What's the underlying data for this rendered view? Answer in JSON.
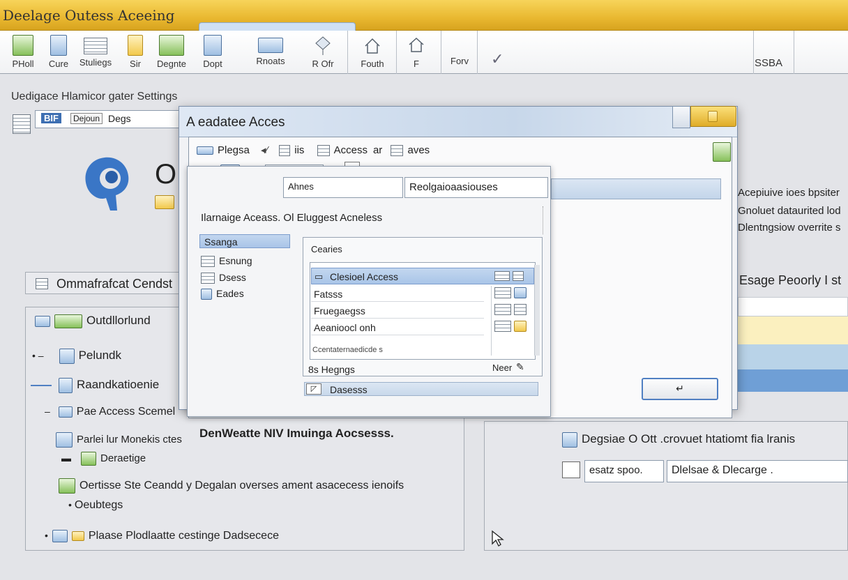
{
  "window": {
    "title": "Deelage Outess Aceeing"
  },
  "ribbon": {
    "buttons": [
      {
        "label": "PHoll"
      },
      {
        "label": "Cure"
      },
      {
        "label": "Stuliegs"
      },
      {
        "label": "Sir"
      },
      {
        "label": "Degnte"
      },
      {
        "label": "Dopt"
      },
      {
        "label": "Rnoats"
      },
      {
        "label": "R Ofr"
      },
      {
        "label": "Fouth"
      },
      {
        "label": "F"
      },
      {
        "label": "Forv"
      }
    ],
    "check_glyph": "✓",
    "right_label": "SSBA"
  },
  "background": {
    "section_title": "Uedigace Hlamicor gater Settings",
    "search_tag": "BIF",
    "search_placeholder": "Dejoun",
    "search_value": "Degs",
    "big_letter": "O",
    "left_header": "Ommafrafcat Cendst",
    "tree": [
      {
        "label": "Outdllorlund"
      },
      {
        "label": "Pelundk"
      },
      {
        "label": "Raandkatioenie"
      },
      {
        "label": "Pae Access Scemel"
      },
      {
        "label": "Parlei lur Monekis ctes"
      },
      {
        "label": "Deraetige"
      },
      {
        "label": "Oertisse Ste Ceandd y Degalan overses ament asacecess ienoifs"
      },
      {
        "label": "Oeubtegs"
      },
      {
        "label": "Plaase Plodlaatte cestinge Dadsecece"
      }
    ],
    "callout": "DenWeatte NIV Imuinga Aocsesss.",
    "right_lines": [
      "Acepiuive ioes bpsiter",
      "Gnoluet dataurited lod",
      "Dlentngsiow overrite s"
    ],
    "right_header": "Esage Peoorly I st",
    "right_bottom_title": "Degsiae O Ott .crovuet htatiomt fia lranis",
    "right_field_a": "esatz spoo.",
    "right_field_b": "Dlelsae & Dlecarge ."
  },
  "dialog": {
    "title": "A eadatee Acces",
    "toolbar": [
      {
        "label": "Plegsa"
      },
      {
        "label": "iis"
      },
      {
        "label": "Access"
      },
      {
        "label": "aves"
      }
    ],
    "ok_glyph": "↵",
    "sub": {
      "field_left": "Ahnes",
      "field_right": "Reolgaioaasiouses",
      "heading": "Ilarnaige Aceass. Ol Eluggest Acneless",
      "nav": [
        {
          "label": "Ssanga",
          "selected": true
        },
        {
          "label": "Esnung"
        },
        {
          "label": "Dsess"
        },
        {
          "label": "Eades"
        }
      ],
      "group_label": "Cearies",
      "list": [
        {
          "label": "Clesioel Access",
          "selected": true
        },
        {
          "label": "Fatsss"
        },
        {
          "label": "Fruegaegss"
        },
        {
          "label": "Aeanioocl onh"
        }
      ],
      "list_footer": "Ccentaternaedicde s",
      "bottom_left": "8s Hegngs",
      "bottom_right": "Neer",
      "bottom_bar": "Dasesss"
    }
  },
  "colors": {
    "title_bar": "#e9b830",
    "selection": "#a9c5e8",
    "accent_blue": "#4f7fc2",
    "band_yellow": "#fbf0bf",
    "band_blue": "#6f9fd6"
  }
}
